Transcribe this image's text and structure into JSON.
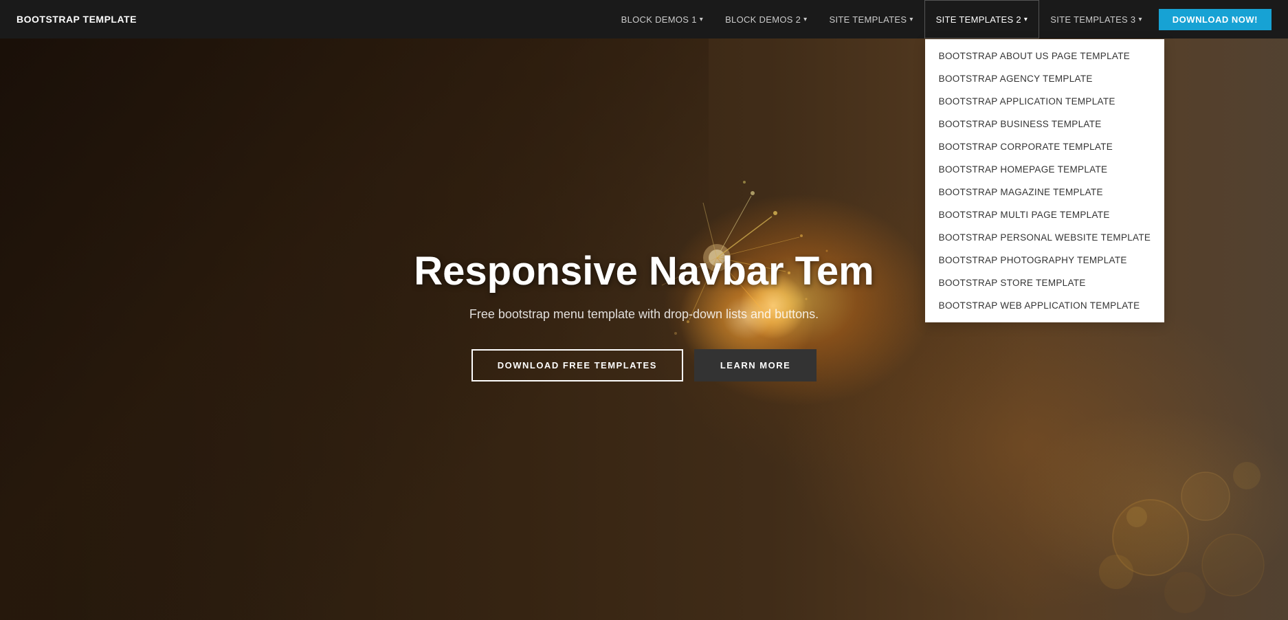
{
  "navbar": {
    "brand": "BOOTSTRAP TEMPLATE",
    "items": [
      {
        "id": "block-demos-1",
        "label": "BLOCK DEMOS 1",
        "hasDropdown": true
      },
      {
        "id": "block-demos-2",
        "label": "BLOCK DEMOS 2",
        "hasDropdown": true
      },
      {
        "id": "site-templates",
        "label": "SITE TEMPLATES",
        "hasDropdown": true
      },
      {
        "id": "site-templates-2",
        "label": "SITE TEMPLATES 2",
        "hasDropdown": true,
        "active": true
      },
      {
        "id": "site-templates-3",
        "label": "SITE TEMPLATES 3",
        "hasDropdown": true
      }
    ],
    "cta": "DOWNLOAD NOW!"
  },
  "dropdown": {
    "items": [
      "Bootstrap About Us Page Template",
      "Bootstrap Agency Template",
      "Bootstrap Application Template",
      "Bootstrap Business Template",
      "Bootstrap Corporate Template",
      "Bootstrap Homepage Template",
      "Bootstrap Magazine Template",
      "Bootstrap Multi Page Template",
      "Bootstrap Personal Website Template",
      "Bootstrap Photography Template",
      "Bootstrap Store Template",
      "Bootstrap Web Application Template"
    ]
  },
  "hero": {
    "title": "Responsive Navbar Tem",
    "subtitle": "Free bootstrap menu template with drop-down lists and buttons.",
    "btn1": "DOWNLOAD FREE TEMPLATES",
    "btn2": "LEARN MORE"
  }
}
